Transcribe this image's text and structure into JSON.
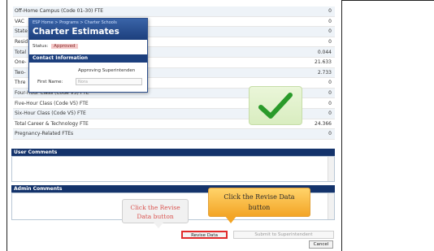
{
  "fte_rows": [
    {
      "label": "Off-Home Campus (Code 01-30) FTE",
      "value": "0"
    },
    {
      "label": "VAC",
      "value": "0"
    },
    {
      "label": "State",
      "value": "0"
    },
    {
      "label": "Resid",
      "value": "0"
    },
    {
      "label": "Total",
      "value": "0.044"
    },
    {
      "label": "One-",
      "value": "21.633"
    },
    {
      "label": "Two-",
      "value": "2.733"
    },
    {
      "label": "Thre",
      "value": "0"
    },
    {
      "label": "Four-Hour Class (Code V5) FTE",
      "value": "0"
    },
    {
      "label": "Five-Hour Class (Code V5) FTE",
      "value": "0"
    },
    {
      "label": "Six-Hour Class (Code V5) FTE",
      "value": "0"
    },
    {
      "label": "Total Career & Technology FTE",
      "value": "24.366"
    },
    {
      "label": "Pregnancy-Related FTEs",
      "value": "0"
    }
  ],
  "sections": {
    "user_comments": "User Comments",
    "admin_comments": "Admin Comments"
  },
  "popup": {
    "breadcrumb": "ESP Home > Programs > Charter Schools",
    "title": "Charter Estimates",
    "status_label": "Status:",
    "status_value": "Approved",
    "contact_header": "Contact Information",
    "approving": "Approving Superintenden",
    "first_name_label": "First Name:",
    "first_name_value": "Nora"
  },
  "callouts": {
    "left_line1": "Click the Revise",
    "left_line2": "Data button",
    "right_line1": "Click the Revise Data",
    "right_line2": "button"
  },
  "buttons": {
    "revise": "Revise Data",
    "submit": "Submit to Superintendent",
    "cancel": "Cancel"
  },
  "colors": {
    "section_bar": "#14336b",
    "highlight_border": "#e12b2b",
    "check_green": "#2a9a2a"
  }
}
